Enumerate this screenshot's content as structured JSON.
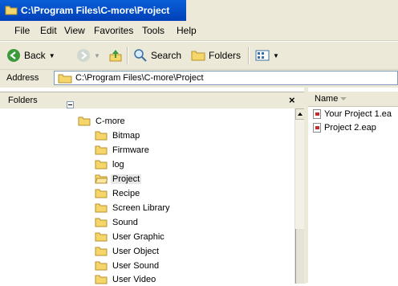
{
  "window": {
    "title": "C:\\Program Files\\C-more\\Project"
  },
  "menu": [
    "File",
    "Edit",
    "View",
    "Favorites",
    "Tools",
    "Help"
  ],
  "toolbar": {
    "back": "Back",
    "search": "Search",
    "folders": "Folders"
  },
  "address": {
    "label": "Address",
    "value": "C:\\Program Files\\C-more\\Project"
  },
  "folders_pane": {
    "title": "Folders",
    "close": "×",
    "tree": [
      {
        "label": "C-more",
        "level": 0,
        "expanded": true
      },
      {
        "label": "Bitmap",
        "level": 1
      },
      {
        "label": "Firmware",
        "level": 1
      },
      {
        "label": "log",
        "level": 1
      },
      {
        "label": "Project",
        "level": 1,
        "selected": true
      },
      {
        "label": "Recipe",
        "level": 1
      },
      {
        "label": "Screen Library",
        "level": 1
      },
      {
        "label": "Sound",
        "level": 1
      },
      {
        "label": "User Graphic",
        "level": 1
      },
      {
        "label": "User Object",
        "level": 1
      },
      {
        "label": "User Sound",
        "level": 1
      },
      {
        "label": "User Video",
        "level": 1
      }
    ]
  },
  "files_pane": {
    "column_name": "Name",
    "files": [
      "Your Project 1.ea",
      "Project 2.eap"
    ]
  },
  "colors": {
    "titlebar": "#0a5fd8",
    "chrome": "#ece9d8",
    "folder": "#f4d66b"
  }
}
